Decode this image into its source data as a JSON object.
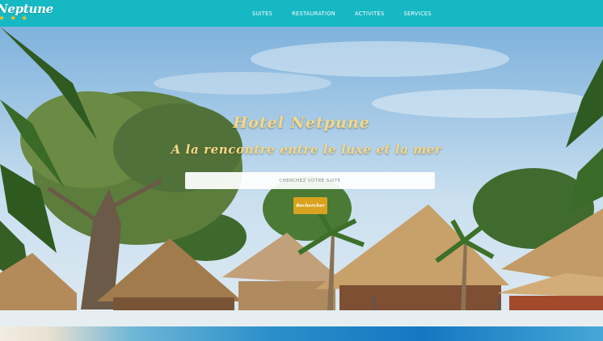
{
  "header": {
    "logo_text": "Neptune",
    "logo_stars": "★★★",
    "nav": [
      {
        "label": "SUITES"
      },
      {
        "label": "RESTAURATION"
      },
      {
        "label": "ACTIVITÉS"
      },
      {
        "label": "SERVICES"
      }
    ]
  },
  "hero": {
    "title": "Hotel Netpune",
    "subtitle": "A la rencontre entre le luxe et la mer",
    "search_placeholder": "CHERCHEZ VOTRE SUITE",
    "search_button": "Rechercher"
  },
  "colors": {
    "nav_bg": "#16b8c3",
    "accent_gold": "#d9a31f",
    "title_gold": "#f2d98a"
  }
}
